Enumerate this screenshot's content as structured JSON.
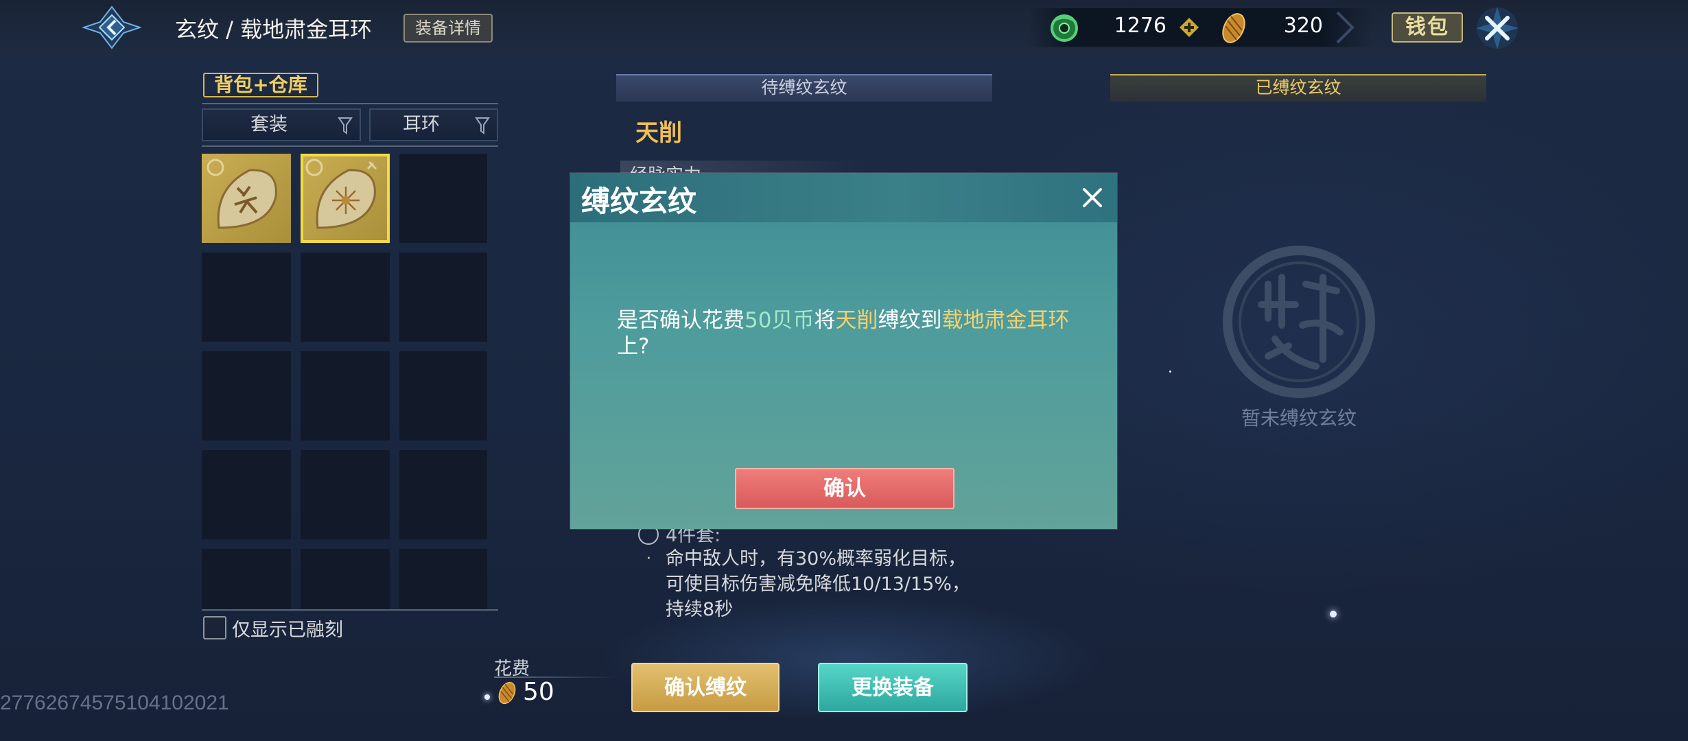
{
  "header": {
    "title": "玄纹 / 载地肃金耳环",
    "detail_button": "装备详情",
    "wallet_button": "钱包"
  },
  "currency": {
    "jade": "1276",
    "shell": "320"
  },
  "inventory": {
    "source_tab": "背包+仓库",
    "filter_set": "套装",
    "filter_slot": "耳环",
    "only_fused_label": "仅显示已融刻",
    "items": [
      {
        "name": "leaf-item-1",
        "selected": false
      },
      {
        "name": "leaf-item-2",
        "selected": true
      }
    ]
  },
  "tabs": {
    "pending": "待缚纹玄纹",
    "bound": "已缚纹玄纹"
  },
  "detail": {
    "set_name": "天削",
    "subheading": "经脉实力",
    "bonus4_title": "4件套:",
    "bonus4_bullet": "·",
    "bonus4_lines": [
      "命中敌人时，有30%概率弱化目标，",
      "可使目标伤害减免降低10/13/15%，",
      "持续8秒"
    ]
  },
  "bound_panel": {
    "empty_text": "暂未缚纹玄纹"
  },
  "footer": {
    "cost_label": "花费",
    "cost_value": "50",
    "confirm_bind": "确认缚纹",
    "swap_equipment": "更换装备",
    "uid": "27762674575104102021"
  },
  "dialog": {
    "title": "缚纹玄纹",
    "msg_part1": "是否确认花费",
    "msg_cost": "50贝币",
    "msg_part2": "将",
    "msg_set": "天削",
    "msg_part3": "缚纹到",
    "msg_item": "载地肃金耳环",
    "msg_part4": "上?",
    "confirm": "确认"
  },
  "colors": {
    "gold_text": "#f0be57",
    "dialog_bg": "#4d9b9c",
    "confirm_red": "#d95a5b",
    "bind_gold": "#c79b42",
    "swap_teal": "#2ea79f"
  }
}
